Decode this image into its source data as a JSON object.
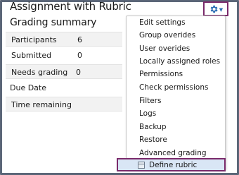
{
  "page": {
    "title": "Assignment with Rubric",
    "subtitle": "Grading summary"
  },
  "summary": {
    "rows": [
      {
        "label": "Participants",
        "value": "6"
      },
      {
        "label": "Submitted",
        "value": "0"
      },
      {
        "label": "Needs grading",
        "value": "0"
      },
      {
        "label": "Due Date",
        "value": ""
      },
      {
        "label": "Time remaining",
        "value": ""
      }
    ]
  },
  "settings_menu": {
    "icon": "gear-icon",
    "items": [
      "Edit settings",
      "Group overides",
      "User overides",
      "Locally assigned roles",
      "Permissions",
      "Check permissions",
      "Filters",
      "Logs",
      "Backup",
      "Restore",
      "Advanced grading"
    ],
    "highlighted_item": "Define rubric",
    "accent_color": "#7a2a6b",
    "highlight_bg": "#d9e6f5"
  }
}
